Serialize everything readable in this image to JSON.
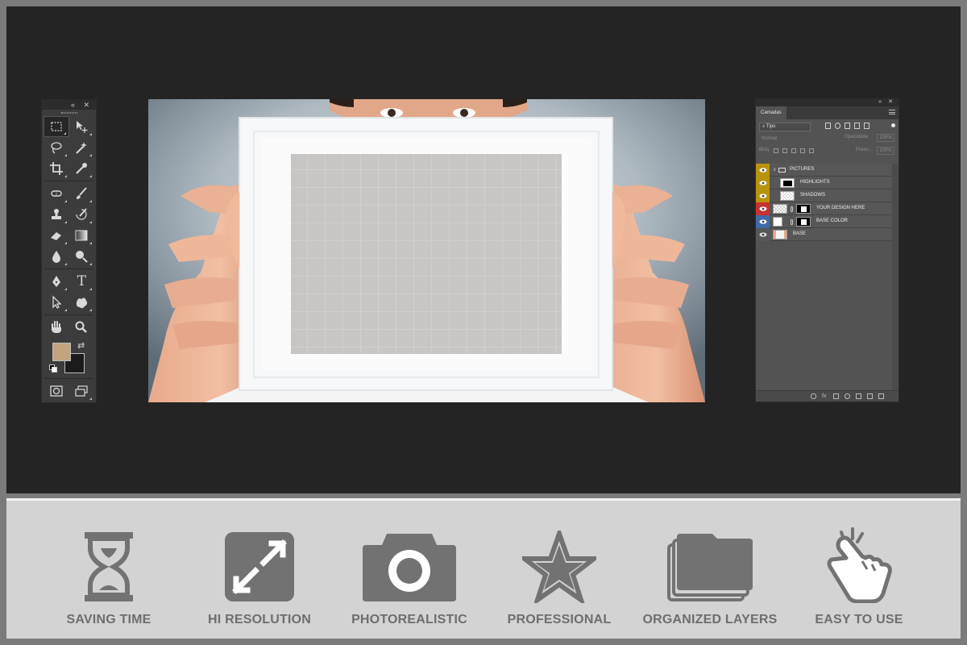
{
  "colors": {
    "workspace_bg": "#242424",
    "feature_bg": "#d3d3d3",
    "feature_icon": "#727272",
    "foreground_color": "#c4a47a",
    "background_color": "#1b1b1b",
    "eye_yellow": "#b8930e",
    "eye_red": "#c83232",
    "eye_blue": "#3f6ca8",
    "eye_gray": "#575757"
  },
  "tools_panel": {
    "header_icons": "«  ✕",
    "tools": [
      [
        "rectangular-marquee-icon",
        "move-icon"
      ],
      [
        "lasso-icon",
        "magic-wand-icon"
      ],
      [
        "crop-icon",
        "eyedropper-icon"
      ],
      [
        "spot-healing-icon",
        "brush-icon"
      ],
      [
        "clone-stamp-icon",
        "history-brush-icon"
      ],
      [
        "eraser-icon",
        "gradient-icon"
      ],
      [
        "blur-icon",
        "dodge-icon"
      ],
      [
        "pen-icon",
        "type-icon"
      ],
      [
        "path-selection-icon",
        "custom-shape-icon"
      ],
      [
        "hand-icon",
        "zoom-icon"
      ]
    ],
    "type_tool_glyph": "T"
  },
  "layers_panel": {
    "header_icons": "«  ✕",
    "tab_label": "Camadas",
    "filter_label": "Tipo",
    "blend_mode": "Normal",
    "opacity_label": "Opacidade:",
    "opacity_value": "100%",
    "lock_label": "Bloq.:",
    "fill_label": "Preen.:",
    "fill_value": "100%",
    "layers": [
      {
        "name": "PICTURES",
        "type": "group",
        "eye": "yellow"
      },
      {
        "name": "HIGHLIGHTS",
        "type": "layer",
        "eye": "yellow"
      },
      {
        "name": "SHADOWS",
        "type": "layer",
        "eye": "yellow"
      },
      {
        "name": "YOUR DESIGN HERE",
        "type": "smart",
        "eye": "red"
      },
      {
        "name": "BASE COLOR",
        "type": "fill",
        "eye": "blue"
      },
      {
        "name": "BASE",
        "type": "image",
        "eye": "gray"
      }
    ]
  },
  "features": [
    {
      "label": "SAVING TIME",
      "icon": "hourglass-icon"
    },
    {
      "label": "HI RESOLUTION",
      "icon": "expand-arrows-icon"
    },
    {
      "label": "PHOTOREALISTIC",
      "icon": "camera-icon"
    },
    {
      "label": "PROFESSIONAL",
      "icon": "star-icon"
    },
    {
      "label": "ORGANIZED LAYERS",
      "icon": "stacked-layers-icon"
    },
    {
      "label": "EASY TO USE",
      "icon": "tap-hand-icon"
    }
  ]
}
